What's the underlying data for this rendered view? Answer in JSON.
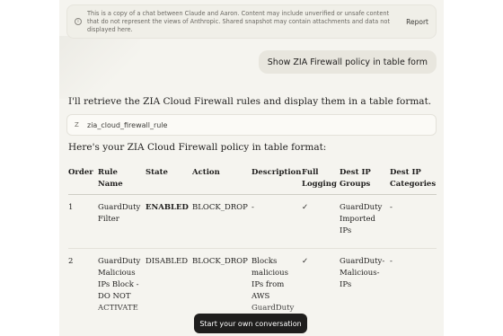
{
  "disclaimer": {
    "text": "This is a copy of a chat between Claude and Aaron. Content may include unverified or unsafe content that do not represent the views of Anthropic. Shared snapshot may contain attachments and data not displayed here.",
    "report_label": "Report",
    "icon": "info-icon"
  },
  "user_message": "Show ZIA Firewall policy in table form",
  "assistant": {
    "intro": "I'll retrieve the ZIA Cloud Firewall rules and display them in a table format.",
    "tool_icon_glyph": "Z",
    "tool_name": "zia_cloud_firewall_rule",
    "heading": "Here's your ZIA Cloud Firewall policy in table format:"
  },
  "table": {
    "headers": [
      "Order",
      "Rule Name",
      "State",
      "Action",
      "Description",
      "Full Logging",
      "Dest IP Groups",
      "Dest IP Categories"
    ],
    "rows": [
      [
        "1",
        "GuardDuty Filter",
        "ENABLED",
        "BLOCK_DROP",
        "-",
        "✓",
        "GuardDuty Imported IPs",
        "-"
      ],
      [
        "2",
        "GuardDuty Malicious IPs Block - DO NOT ACTIVATE",
        "DISABLED",
        "BLOCK_DROP",
        "Blocks malicious IPs from AWS GuardDuty findings",
        "✓",
        "GuardDuty-Malicious-IPs",
        "-"
      ]
    ]
  },
  "cta_label": "Start your own conversation"
}
